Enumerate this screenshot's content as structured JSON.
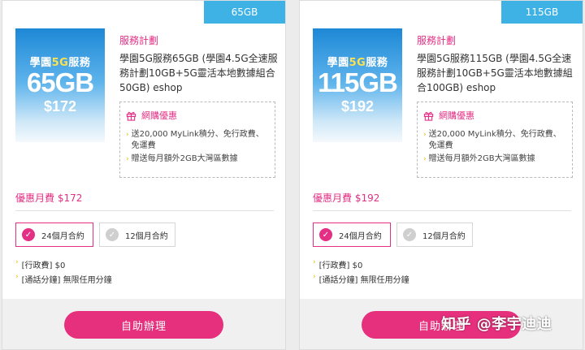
{
  "colors": {
    "accent": "#e32f84",
    "tag": "#3fb2e5",
    "button": "#e6307d"
  },
  "cards": [
    {
      "tag": "65GB",
      "image": {
        "line1_a": "學園",
        "line1_b": "5G",
        "line1_c": "服務",
        "size": "65GB",
        "price": "$172"
      },
      "plan_title": "服務計劃",
      "plan_desc": "學園5G服務65GB (學園4.5G全速服務計劃10GB+5G靈活本地數據組合50GB) eshop",
      "promo": {
        "title": "網購優惠",
        "items": [
          "送20,000 MyLink積分、免行政費、免運費",
          "贈送每月額外2GB大灣區數據"
        ]
      },
      "monthly_fee": "優惠月費 $172",
      "contract_options": [
        {
          "label": "24個月合約",
          "selected": true
        },
        {
          "label": "12個月合約",
          "selected": false
        }
      ],
      "fees": [
        "[行政費] $0",
        "[通話分鐘] 無限任用分鐘"
      ],
      "button": "自助辦理"
    },
    {
      "tag": "115GB",
      "image": {
        "line1_a": "學園",
        "line1_b": "5G",
        "line1_c": "服務",
        "size": "115GB",
        "price": "$192"
      },
      "plan_title": "服務計劃",
      "plan_desc": "學園5G服務115GB (學園4.5G全速服務計劃10GB+5G靈活本地數據組合100GB) eshop",
      "promo": {
        "title": "網購優惠",
        "items": [
          "送20,000 MyLink積分、免行政費、免運費",
          "贈送每月額外2GB大灣區數據"
        ]
      },
      "monthly_fee": "優惠月費 $192",
      "contract_options": [
        {
          "label": "24個月合約",
          "selected": true
        },
        {
          "label": "12個月合約",
          "selected": false
        }
      ],
      "fees": [
        "[行政費] $0",
        "[通話分鐘] 無限任用分鐘"
      ],
      "button": "自助辦理"
    }
  ],
  "watermark": "知乎 @李宇迪迪"
}
